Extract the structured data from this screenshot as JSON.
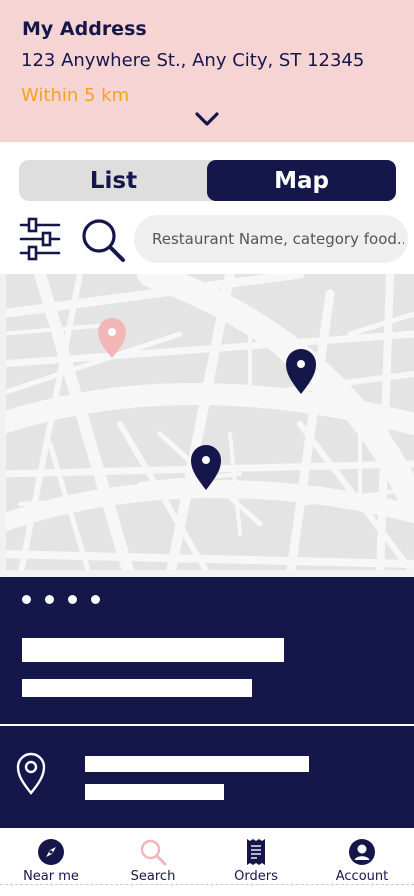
{
  "colors": {
    "navy": "#15164a",
    "pink_bg": "#f7d4d4",
    "orange": "#f6a21d",
    "pin_light": "#f2b6b6",
    "map_bg": "#e4e4e4",
    "road": "#ffffff"
  },
  "address": {
    "title": "My Address",
    "line": "123 Anywhere St., Any City, ST 12345",
    "radius": "Within 5 km",
    "expand_icon": "chevron-down-icon"
  },
  "view_toggle": {
    "list_label": "List",
    "map_label": "Map",
    "selected": "Map"
  },
  "search": {
    "placeholder": "Restaurant Name, category food...",
    "value": "",
    "filter_icon": "filter-sliders-icon",
    "search_icon": "search-icon"
  },
  "map": {
    "pins": [
      {
        "name": "current-location-pin",
        "color": "#f2b6b6"
      },
      {
        "name": "restaurant-pin",
        "color": "#15164a"
      },
      {
        "name": "restaurant-pin",
        "color": "#15164a"
      }
    ]
  },
  "restaurant_card": {
    "rating_dots": 4,
    "location_icon": "location-pin-icon"
  },
  "bottom_nav": {
    "items": [
      {
        "label": "Near me",
        "icon": "compass-icon",
        "active": false
      },
      {
        "label": "Search",
        "icon": "search-icon",
        "active": true
      },
      {
        "label": "Orders",
        "icon": "receipt-icon",
        "active": false
      },
      {
        "label": "Account",
        "icon": "account-icon",
        "active": false
      }
    ]
  }
}
